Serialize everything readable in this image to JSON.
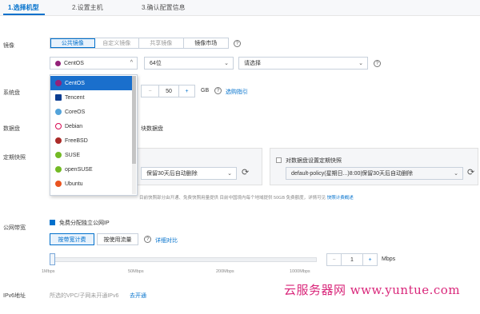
{
  "steps": [
    {
      "label": "1.选择机型",
      "active": true
    },
    {
      "label": "2.设置主机",
      "active": false
    },
    {
      "label": "3.确认配置信息",
      "active": false
    }
  ],
  "image": {
    "label": "镜像",
    "tabs": [
      "公共镜像",
      "自定义镜像",
      "共享镜像",
      "镜像市场"
    ],
    "os_value": "CentOS",
    "bits_value": "64位",
    "version_placeholder": "请选择"
  },
  "os_dropdown": {
    "items": [
      {
        "name": "CentOS",
        "selected": true,
        "icon": "centos-icon",
        "color": "#932279"
      },
      {
        "name": "Tencent",
        "selected": false,
        "icon": "tencent-icon",
        "color": "#0b3d91"
      },
      {
        "name": "CoreOS",
        "selected": false,
        "icon": "coreos-icon",
        "color": "#53a3da"
      },
      {
        "name": "Debian",
        "selected": false,
        "icon": "debian-icon",
        "color": "#d70a53"
      },
      {
        "name": "FreeBSD",
        "selected": false,
        "icon": "freebsd-icon",
        "color": "#ab2b28"
      },
      {
        "name": "SUSE",
        "selected": false,
        "icon": "suse-icon",
        "color": "#73ba25"
      },
      {
        "name": "openSUSE",
        "selected": false,
        "icon": "opensuse-icon",
        "color": "#73ba25"
      },
      {
        "name": "Ubuntu",
        "selected": false,
        "icon": "ubuntu-icon",
        "color": "#e95420"
      }
    ]
  },
  "system_disk": {
    "label": "系统盘",
    "size": "50",
    "unit": "GB",
    "guide_link": "选购指引"
  },
  "data_disk": {
    "label": "数据盘",
    "add_text": "块数据盘"
  },
  "snapshot": {
    "label": "定期快照",
    "left_policy": "保留30天后自动删除",
    "right_check_label": "对数据盘设置定期快照",
    "right_policy": "default-policy(星期日...)8:00|保留30天后自动删除",
    "note": "目前快照部分由开通、免费快照用量提供 目前中国境内每个地域提供 50GB 免费额度，详情可见",
    "note_link": "快照计费概述"
  },
  "bandwidth": {
    "label": "公网带宽",
    "free_ip_label": "免费分配独立公网IP",
    "mode_bandwidth": "按带宽计费",
    "mode_traffic": "按使用流量",
    "detail_link": "详细对比",
    "ticks": [
      "1Mbps",
      "50Mbps",
      "200Mbps",
      "1000Mbps"
    ],
    "value": "1",
    "unit": "Mbps"
  },
  "ipv6": {
    "label": "IPv6地址",
    "text": "所选的VPC/子网未开通IPv6",
    "link": "去开通"
  },
  "watermark": "云服务器网 www.yuntue.com",
  "colors": {
    "accent": "#0070cc",
    "selected": "#1a6fcc",
    "watermark": "#d9267a"
  }
}
